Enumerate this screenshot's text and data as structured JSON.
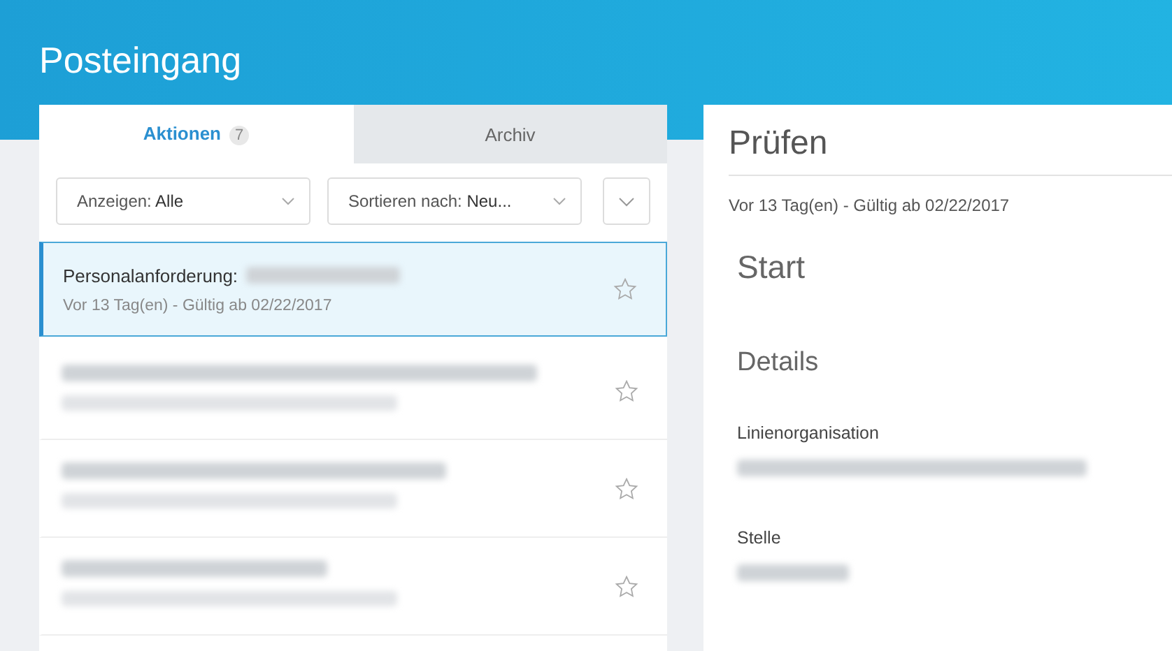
{
  "page": {
    "title": "Posteingang"
  },
  "tabs": [
    {
      "label": "Aktionen",
      "count": "7",
      "selected": true
    },
    {
      "label": "Archiv",
      "selected": false
    }
  ],
  "filters": [
    {
      "label": "Anzeigen:",
      "value": "Alle"
    },
    {
      "label": "Sortieren nach:",
      "value": "Neu..."
    }
  ],
  "items": [
    {
      "title": "Personalanforderung:",
      "subtitle": "Vor 13 Tag(en) - Gültig ab 02/22/2017",
      "selected": true
    },
    {
      "selected": false
    },
    {
      "selected": false
    },
    {
      "selected": false
    }
  ],
  "detail": {
    "title": "Prüfen",
    "meta": "Vor 13 Tag(en) - Gültig ab 02/22/2017",
    "section": "Start",
    "subsection": "Details",
    "fields": [
      {
        "label": "Linienorganisation"
      },
      {
        "label": "Stelle"
      }
    ]
  }
}
